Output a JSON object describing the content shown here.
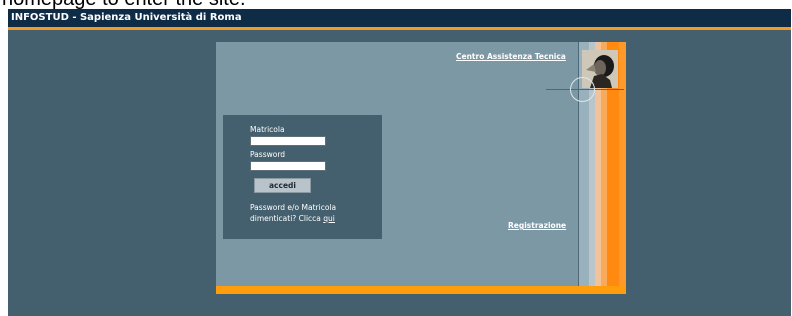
{
  "caption": "homepage to enter the site.",
  "header": {
    "title": "INFOSTUD - Sapienza Università di Roma"
  },
  "links": {
    "assistance": "Centro Assistenza Tecnica",
    "registration": "Registrazione"
  },
  "login": {
    "matricola_label": "Matricola",
    "matricola_value": "",
    "password_label": "Password",
    "password_value": "",
    "submit_label": "accedi",
    "forgot_text": "Password e/o Matricola dimenticati? Clicca",
    "forgot_link": "qui"
  },
  "colors": {
    "background": "#44606f",
    "panel": "#7d98a5",
    "accent": "#ff9d0d",
    "titlebar": "#0f2c47"
  },
  "icons": {
    "portrait": "bust-portrait-icon",
    "circle": "circle-ornament-icon"
  }
}
